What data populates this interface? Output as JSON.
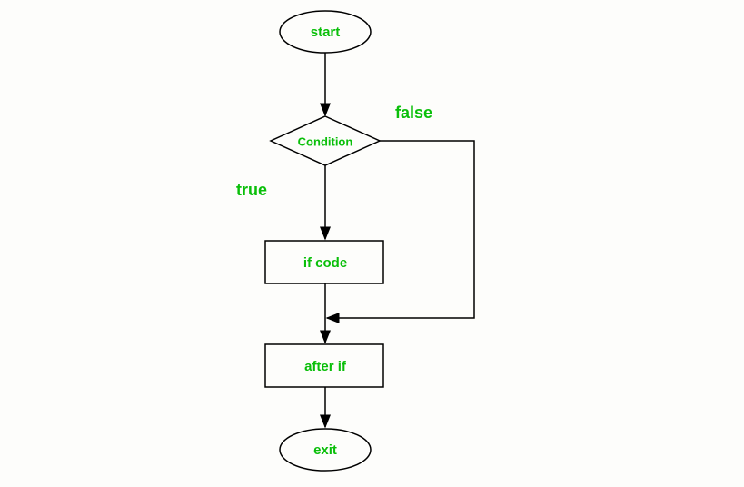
{
  "nodes": {
    "start": "start",
    "condition": "Condition",
    "ifcode": "if code",
    "afterif": "after if",
    "exit": "exit"
  },
  "labels": {
    "true": "true",
    "false": "false"
  },
  "chart_data": {
    "type": "flowchart",
    "nodes": [
      {
        "id": "start",
        "shape": "ellipse",
        "label": "start"
      },
      {
        "id": "condition",
        "shape": "diamond",
        "label": "Condition"
      },
      {
        "id": "ifcode",
        "shape": "rectangle",
        "label": "if code"
      },
      {
        "id": "afterif",
        "shape": "rectangle",
        "label": "after if"
      },
      {
        "id": "exit",
        "shape": "ellipse",
        "label": "exit"
      }
    ],
    "edges": [
      {
        "from": "start",
        "to": "condition"
      },
      {
        "from": "condition",
        "to": "ifcode",
        "label": "true"
      },
      {
        "from": "condition",
        "to": "afterif",
        "label": "false",
        "path": "right-down"
      },
      {
        "from": "ifcode",
        "to": "afterif"
      },
      {
        "from": "afterif",
        "to": "exit"
      }
    ]
  }
}
